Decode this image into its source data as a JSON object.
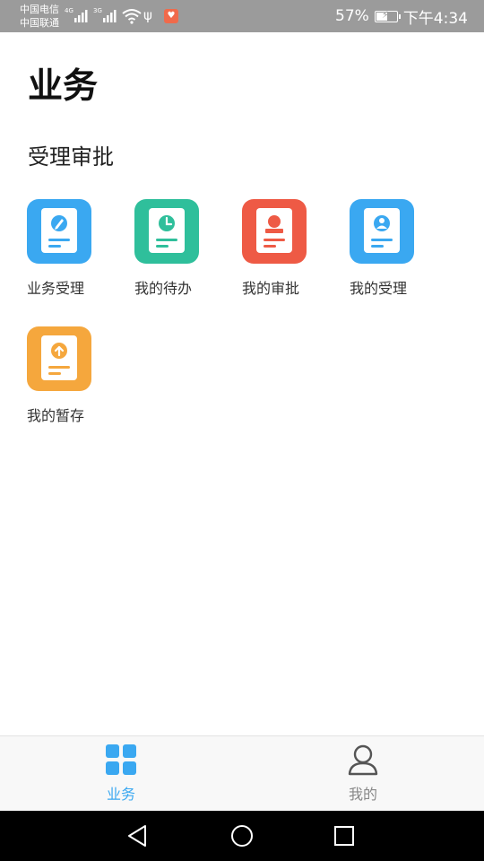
{
  "status_bar": {
    "carrier1": "中国电信",
    "carrier2": "中国联通",
    "net1": "4G",
    "net2": "3G",
    "battery_percent": "57%",
    "battery_level": 0.57,
    "time": "下午4:34"
  },
  "page": {
    "title": "业务"
  },
  "section": {
    "title": "受理审批",
    "tiles": [
      {
        "label": "业务受理",
        "color": "#3aa8f1",
        "icon": "edit-doc-icon"
      },
      {
        "label": "我的待办",
        "color": "#2fbf9b",
        "icon": "clock-doc-icon"
      },
      {
        "label": "我的审批",
        "color": "#ee5a45",
        "icon": "stamp-doc-icon"
      },
      {
        "label": "我的受理",
        "color": "#3aa8f1",
        "icon": "user-doc-icon"
      },
      {
        "label": "我的暂存",
        "color": "#f5a73d",
        "icon": "upload-doc-icon"
      }
    ]
  },
  "bottom_nav": {
    "items": [
      {
        "label": "业务",
        "active": true,
        "icon": "grid-icon"
      },
      {
        "label": "我的",
        "active": false,
        "icon": "person-icon"
      }
    ],
    "active_color": "#3aa8f1",
    "inactive_color": "#888888"
  }
}
